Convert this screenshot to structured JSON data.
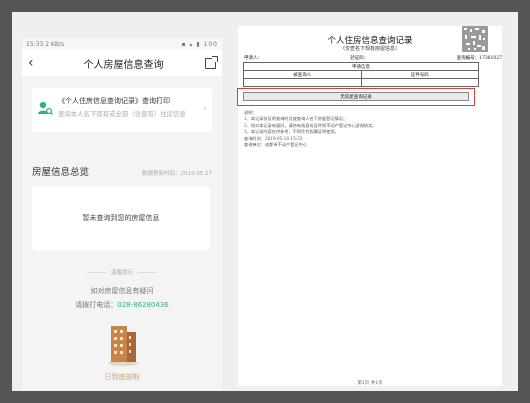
{
  "status_bar": {
    "time": "15:33",
    "network": "2 KB/s",
    "battery": "100"
  },
  "nav": {
    "title": "个人房屋信息查询"
  },
  "record_card": {
    "title": "《个人住房信息查询记录》查询打印",
    "desc": "查询本人名下现有或全部（含曾有）住房信息"
  },
  "overview": {
    "title": "房屋信息总览",
    "date": "数据更新时间：2019.05.17"
  },
  "empty_card": {
    "text": "暂未查询到您的房屋信息"
  },
  "hint": {
    "header": "温馨提示",
    "question": "如对房屋信息有疑问",
    "call_prefix": "请拨打电话：",
    "phone": "028-86280436"
  },
  "bottom_text": "已到底部啦",
  "document": {
    "title": "个人住房信息查询记录",
    "subtitle": "（仅查名下现有房屋信息）",
    "applicant_label": "申请人：",
    "id_label": "验证码：",
    "query_no_label": "查询编号：",
    "query_no": "17361027",
    "table": {
      "header": "申请信息",
      "col1": "被查询人",
      "col2": "证件号码"
    },
    "result": "无房屋查询记录",
    "notes": [
      "说明：",
      "1、本记录仅证明查询时点被查询人名下房屋登记情况。",
      "2、如对本记录有疑问，请持有效身份证件到不动产登记中心咨询核实。",
      "3、本记录内容仅供参考，不得作为权属证明使用。",
      "查询时间：2019-05-18 15:33",
      "查询单位：成都市不动产登记中心"
    ],
    "page_number": "第1页 共1页"
  }
}
